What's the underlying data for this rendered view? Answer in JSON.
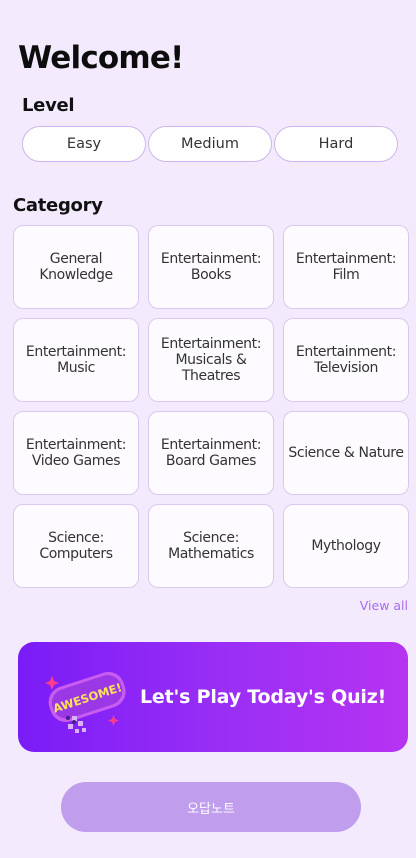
{
  "header": {
    "title": "Welcome!"
  },
  "level": {
    "label": "Level",
    "options": [
      "Easy",
      "Medium",
      "Hard"
    ]
  },
  "category": {
    "label": "Category",
    "items": [
      "General\nKnowledge",
      "Entertainment:\nBooks",
      "Entertainment: Film",
      "Entertainment:\nMusic",
      "Entertainment:\nMusicals &\nTheatres",
      "Entertainment:\nTelevision",
      "Entertainment:\nVideo Games",
      "Entertainment:\nBoard Games",
      "Science & Nature",
      "Science:\nComputers",
      "Science:\nMathematics",
      "Mythology"
    ],
    "view_all": "View all"
  },
  "banner": {
    "sticker_text": "AWESOME!",
    "text": "Let's Play Today's Quiz!",
    "colors": {
      "start": "#7a1cf6",
      "end": "#b733f2"
    }
  },
  "bottom_button": {
    "label": "오답노트",
    "color": "#c09ded"
  }
}
